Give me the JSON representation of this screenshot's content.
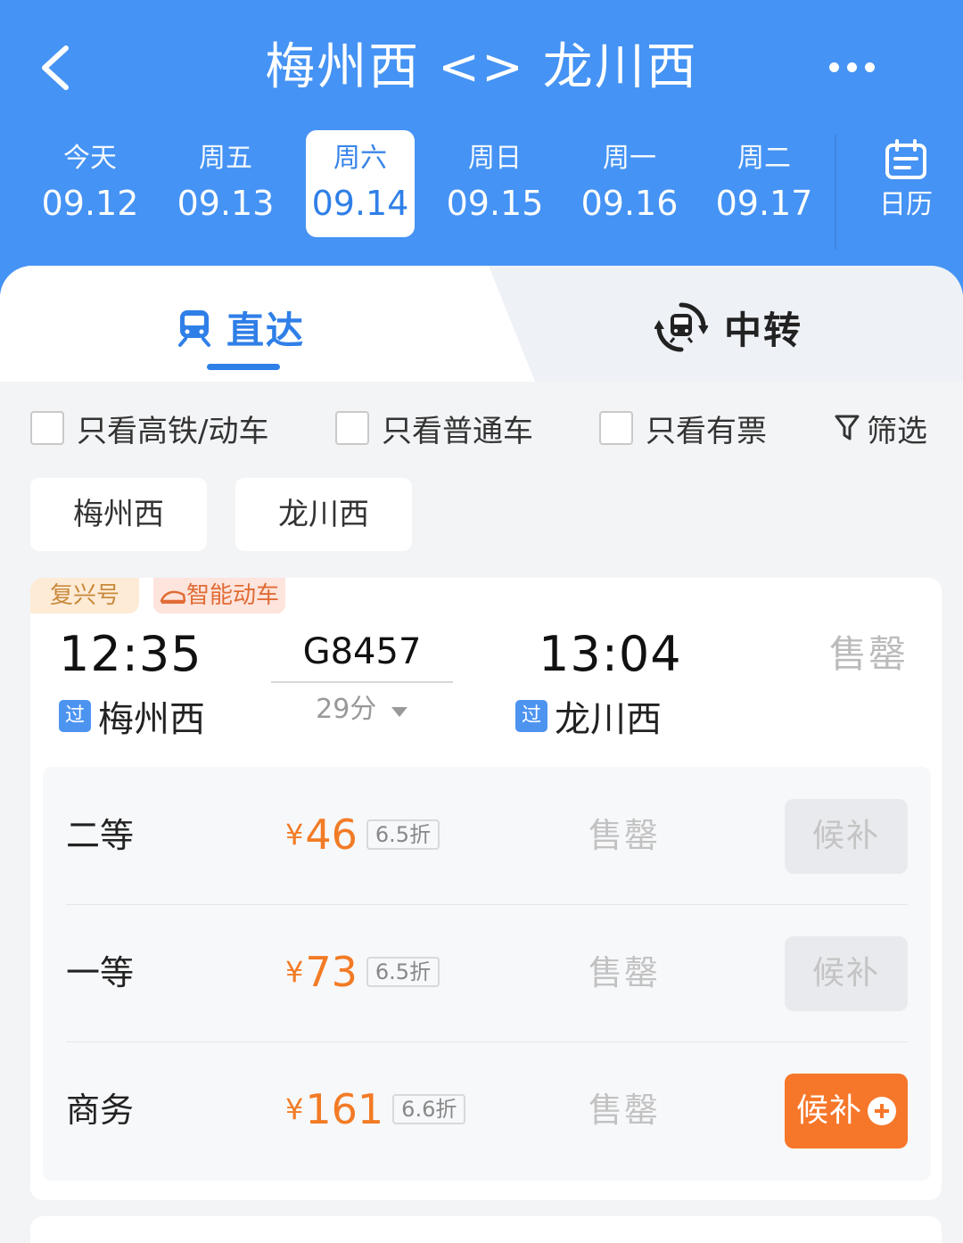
{
  "header": {
    "title": "梅州西 <> 龙川西",
    "dates": [
      {
        "weekday": "今天",
        "date": "09.12",
        "selected": false
      },
      {
        "weekday": "周五",
        "date": "09.13",
        "selected": false
      },
      {
        "weekday": "周六",
        "date": "09.14",
        "selected": true
      },
      {
        "weekday": "周日",
        "date": "09.15",
        "selected": false
      },
      {
        "weekday": "周一",
        "date": "09.16",
        "selected": false
      },
      {
        "weekday": "周二",
        "date": "09.17",
        "selected": false
      }
    ],
    "calendar_label": "日历"
  },
  "modes": {
    "direct": "直达",
    "transfer": "中转",
    "active": "direct"
  },
  "filters": {
    "high_speed": "只看高铁/动车",
    "normal": "只看普通车",
    "available": "只看有票",
    "filter_btn": "筛选"
  },
  "stations": {
    "from": "梅州西",
    "to": "龙川西"
  },
  "train": {
    "tag_fuxing": "复兴号",
    "tag_smart": "智能动车",
    "depart_time": "12:35",
    "arrive_time": "13:04",
    "number": "G8457",
    "duration": "29分",
    "pass_badge": "过",
    "from_station": "梅州西",
    "to_station": "龙川西",
    "status": "售罄",
    "seats": [
      {
        "class": "二等",
        "currency": "¥",
        "price": "46",
        "discount": "6.5折",
        "status": "售罄",
        "action": "候补",
        "action_enabled": false
      },
      {
        "class": "一等",
        "currency": "¥",
        "price": "73",
        "discount": "6.5折",
        "status": "售罄",
        "action": "候补",
        "action_enabled": false
      },
      {
        "class": "商务",
        "currency": "¥",
        "price": "161",
        "discount": "6.6折",
        "status": "售罄",
        "action": "候补",
        "action_enabled": true
      }
    ]
  },
  "colors": {
    "header_bg": "#4593f4",
    "accent_blue": "#2f7fe8",
    "price_orange": "#f27b25",
    "wait_active": "#f6772a"
  }
}
